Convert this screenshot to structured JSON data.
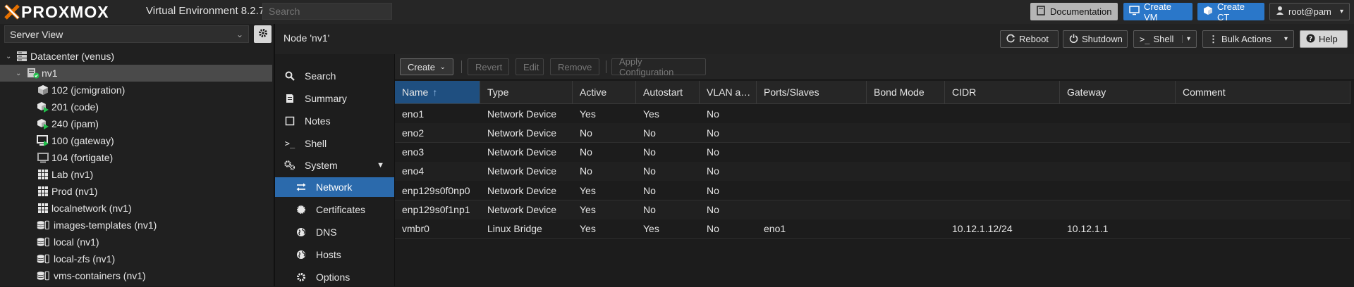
{
  "topbar": {
    "logo_text": "PROXMOX",
    "version": "Virtual Environment 8.2.7",
    "search_placeholder": "Search",
    "documentation": "Documentation",
    "create_vm": "Create VM",
    "create_ct": "Create CT",
    "user": "root@pam"
  },
  "tree": {
    "view": "Server View",
    "items": [
      {
        "label": "Datacenter (venus)",
        "icon": "datacenter-icon"
      },
      {
        "label": "nv1",
        "icon": "node-icon"
      },
      {
        "label": "102 (jcmigration)",
        "icon": "container-icon"
      },
      {
        "label": "201 (code)",
        "icon": "container-running-icon"
      },
      {
        "label": "240 (ipam)",
        "icon": "container-running-icon"
      },
      {
        "label": "100 (gateway)",
        "icon": "vm-running-icon"
      },
      {
        "label": "104 (fortigate)",
        "icon": "vm-icon"
      },
      {
        "label": "Lab (nv1)",
        "icon": "sdn-zone-icon"
      },
      {
        "label": "Prod (nv1)",
        "icon": "sdn-zone-icon"
      },
      {
        "label": "localnetwork (nv1)",
        "icon": "sdn-zone-icon"
      },
      {
        "label": "images-templates (nv1)",
        "icon": "storage-icon"
      },
      {
        "label": "local (nv1)",
        "icon": "storage-icon"
      },
      {
        "label": "local-zfs (nv1)",
        "icon": "storage-icon"
      },
      {
        "label": "vms-containers (nv1)",
        "icon": "storage-icon"
      }
    ]
  },
  "header": {
    "title": "Node 'nv1'",
    "reboot": "Reboot",
    "shutdown": "Shutdown",
    "shell": "Shell",
    "bulk_actions": "Bulk Actions",
    "help": "Help"
  },
  "nav": {
    "items": [
      {
        "label": "Search",
        "icon": "search-icon"
      },
      {
        "label": "Summary",
        "icon": "summary-icon"
      },
      {
        "label": "Notes",
        "icon": "notes-icon"
      },
      {
        "label": "Shell",
        "icon": "terminal-icon"
      },
      {
        "label": "System",
        "icon": "gears-icon"
      },
      {
        "label": "Network",
        "icon": "network-icon"
      },
      {
        "label": "Certificates",
        "icon": "certificate-icon"
      },
      {
        "label": "DNS",
        "icon": "globe-icon"
      },
      {
        "label": "Hosts",
        "icon": "globe-icon"
      },
      {
        "label": "Options",
        "icon": "gear-icon"
      }
    ]
  },
  "toolbar": {
    "create": "Create",
    "revert": "Revert",
    "edit": "Edit",
    "remove": "Remove",
    "apply": "Apply Configuration"
  },
  "grid": {
    "columns": [
      "Name",
      "Type",
      "Active",
      "Autostart",
      "VLAN a…",
      "Ports/Slaves",
      "Bond Mode",
      "CIDR",
      "Gateway",
      "Comment"
    ],
    "rows": [
      [
        "eno1",
        "Network Device",
        "Yes",
        "Yes",
        "No",
        "",
        "",
        "",
        "",
        ""
      ],
      [
        "eno2",
        "Network Device",
        "No",
        "No",
        "No",
        "",
        "",
        "",
        "",
        ""
      ],
      [
        "eno3",
        "Network Device",
        "No",
        "No",
        "No",
        "",
        "",
        "",
        "",
        ""
      ],
      [
        "eno4",
        "Network Device",
        "No",
        "No",
        "No",
        "",
        "",
        "",
        "",
        ""
      ],
      [
        "enp129s0f0np0",
        "Network Device",
        "Yes",
        "No",
        "No",
        "",
        "",
        "",
        "",
        ""
      ],
      [
        "enp129s0f1np1",
        "Network Device",
        "Yes",
        "No",
        "No",
        "",
        "",
        "",
        "",
        ""
      ],
      [
        "vmbr0",
        "Linux Bridge",
        "Yes",
        "Yes",
        "No",
        "eno1",
        "",
        "10.12.1.12/24",
        "10.12.1.1",
        ""
      ]
    ]
  },
  "colors": {
    "accent": "#2a77c9",
    "logo_x": "#e57000",
    "running": "#21bf4b"
  }
}
